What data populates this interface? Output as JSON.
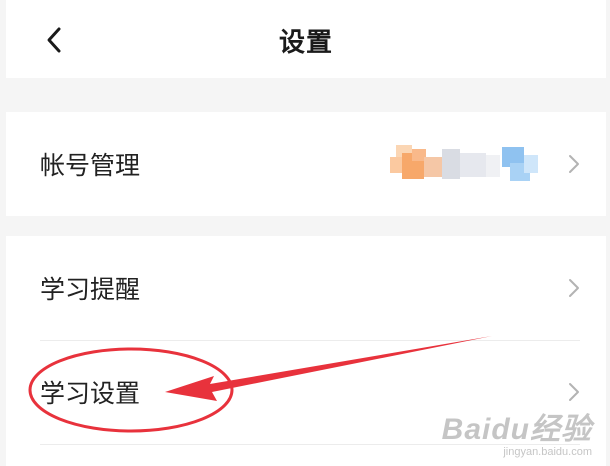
{
  "header": {
    "title": "设置",
    "back_icon": "chevron-left-icon"
  },
  "settings": {
    "account": {
      "label": "帐号管理",
      "icon": "chevron-right-icon"
    },
    "reminder": {
      "label": "学习提醒",
      "icon": "chevron-right-icon"
    },
    "study": {
      "label": "学习设置",
      "icon": "chevron-right-icon"
    }
  },
  "annotation": {
    "color": "#e8323c"
  },
  "watermark": {
    "logo": "Baidu经验",
    "url": "jingyan.baidu.com"
  },
  "colors": {
    "background": "#f5f5f5",
    "panel": "#ffffff",
    "text": "#222222",
    "chevron": "#b3b3b3"
  }
}
